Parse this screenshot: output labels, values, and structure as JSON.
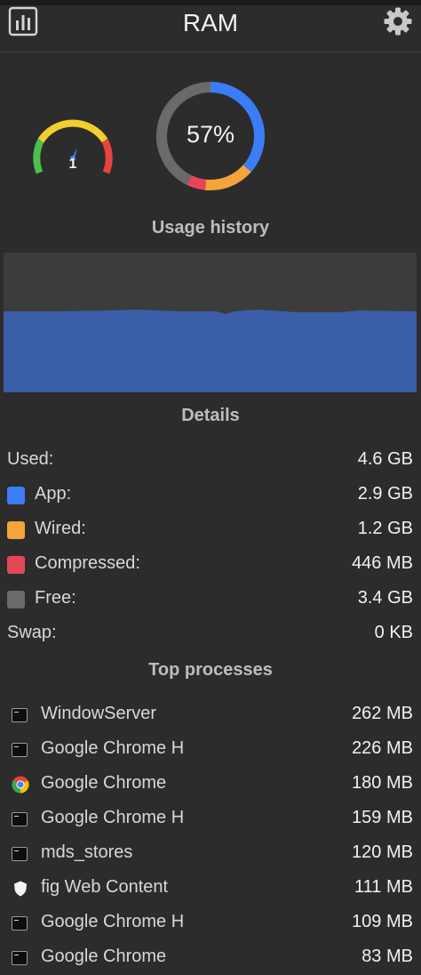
{
  "header": {
    "title": "RAM"
  },
  "gauge": {
    "value_label": "1",
    "level": 0.4
  },
  "donut": {
    "label": "57%",
    "segments": [
      {
        "name": "App",
        "value": 2.9,
        "color": "#3a7df6"
      },
      {
        "name": "Wired",
        "value": 1.2,
        "color": "#f3a43a"
      },
      {
        "name": "Compressed",
        "value": 0.446,
        "color": "#e5465a"
      },
      {
        "name": "Free",
        "value": 3.4,
        "color": "#6a6a6a"
      }
    ]
  },
  "history": {
    "title": "Usage history",
    "fill_color": "#3b5ea8",
    "level": 0.57
  },
  "details": {
    "title": "Details",
    "used": {
      "label": "Used:",
      "value": "4.6 GB"
    },
    "app": {
      "label": "App:",
      "value": "2.9 GB",
      "color": "#3a7df6"
    },
    "wired": {
      "label": "Wired:",
      "value": "1.2 GB",
      "color": "#f3a43a"
    },
    "compressed": {
      "label": "Compressed:",
      "value": "446 MB",
      "color": "#e5465a"
    },
    "free": {
      "label": "Free:",
      "value": "3.4 GB",
      "color": "#6a6a6a"
    },
    "swap": {
      "label": "Swap:",
      "value": "0 KB"
    }
  },
  "processes": {
    "title": "Top processes",
    "items": [
      {
        "name": "WindowServer",
        "memory": "262 MB",
        "icon": "terminal-icon"
      },
      {
        "name": "Google Chrome H",
        "memory": "226 MB",
        "icon": "terminal-icon"
      },
      {
        "name": "Google Chrome",
        "memory": "180 MB",
        "icon": "chrome-icon"
      },
      {
        "name": "Google Chrome H",
        "memory": "159 MB",
        "icon": "terminal-icon"
      },
      {
        "name": "mds_stores",
        "memory": "120 MB",
        "icon": "terminal-icon"
      },
      {
        "name": "fig Web Content",
        "memory": "111 MB",
        "icon": "shield-icon"
      },
      {
        "name": "Google Chrome H",
        "memory": "109 MB",
        "icon": "terminal-icon"
      },
      {
        "name": "Google Chrome",
        "memory": "83 MB",
        "icon": "terminal-icon"
      }
    ]
  }
}
